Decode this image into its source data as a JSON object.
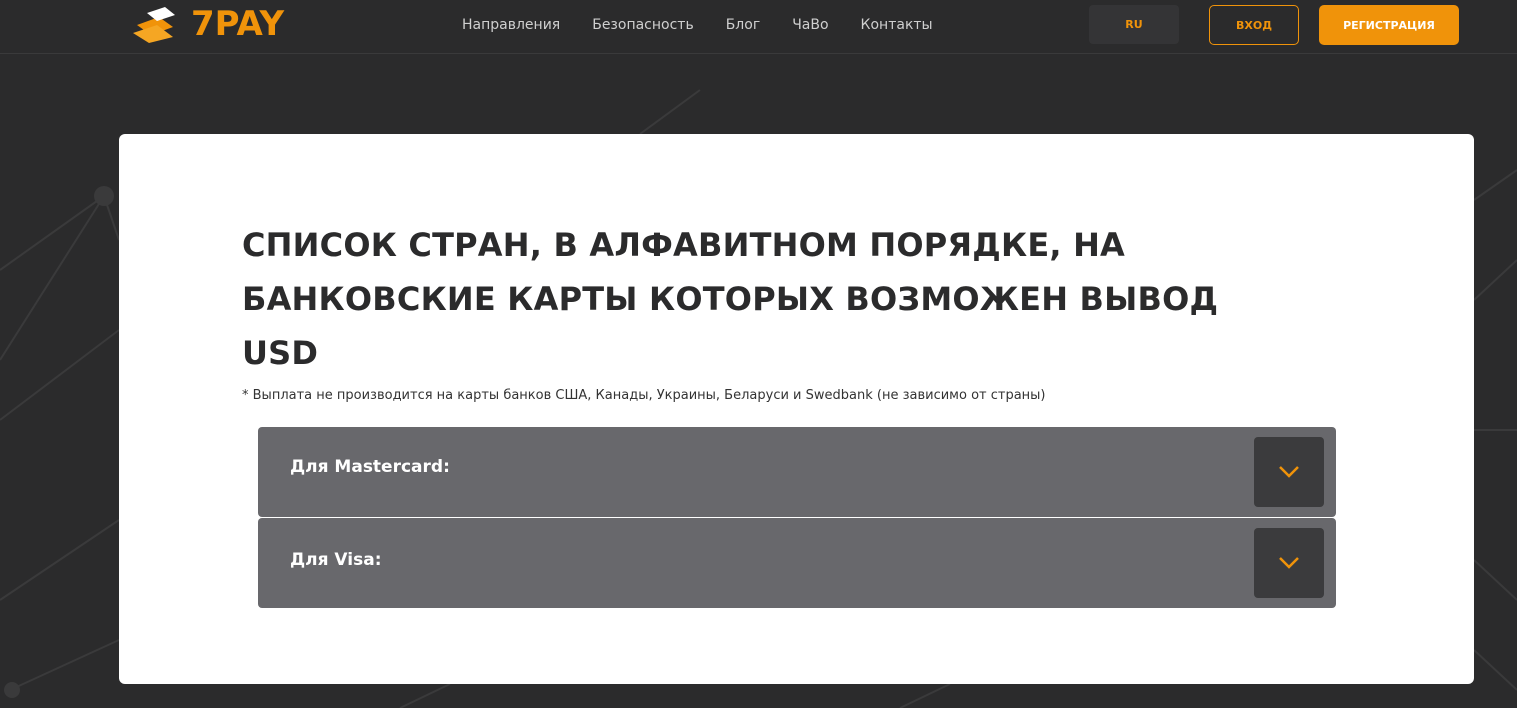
{
  "header": {
    "logo_text": "7PAY",
    "nav": [
      "Направления",
      "Безопасность",
      "Блог",
      "ЧаВо",
      "Контакты"
    ],
    "lang_label": "RU",
    "login_label": "ВХОД",
    "register_label": "РЕГИСТРАЦИЯ"
  },
  "content": {
    "title": "СПИСОК СТРАН, В АЛФАВИТНОМ ПОРЯДКЕ, НА БАНКОВСКИЕ КАРТЫ КОТОРЫХ ВОЗМОЖЕН ВЫВОД USD",
    "note": "* Выплата не производится на карты банков США, Канады, Украины, Беларуси и Swedbank (не зависимо от страны)",
    "accordions": [
      {
        "label": "Для Mastercard:"
      },
      {
        "label": "Для Visa:"
      }
    ]
  },
  "colors": {
    "accent": "#f0930a",
    "background": "#2b2b2c",
    "accordion": "#68686c"
  },
  "icons": {
    "logo": "gold-bars-icon",
    "toggle": "chevron-down-icon"
  }
}
